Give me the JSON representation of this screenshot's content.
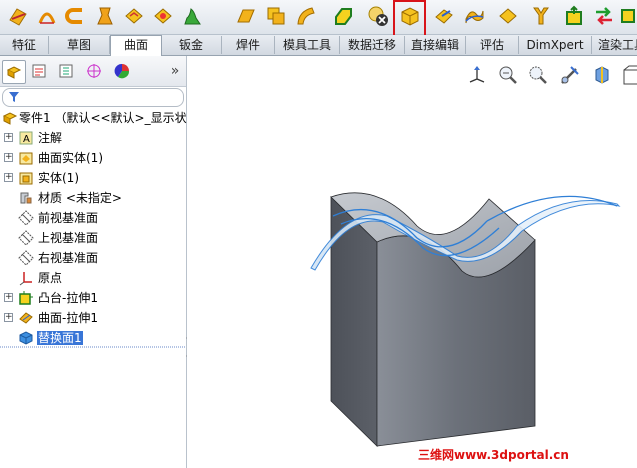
{
  "toolbar": {
    "icons": [
      "planar-surface-icon",
      "extruded-surface-icon",
      "revolved-surface-icon",
      "swept-surface-icon",
      "lofted-surface-icon",
      "boundary-surface-icon",
      "fill-surface-icon",
      "offset-surface-icon",
      "ruled-surface-icon",
      "knit-surface-icon",
      "thicken-icon",
      "delete-face-icon",
      "replace-face-icon",
      "extend-surface-icon",
      "trim-surface-icon",
      "untrim-surface-icon",
      "cut-with-surface-icon",
      "move-face-icon",
      "mirror-icon",
      "freeform-icon"
    ],
    "highlighted_tool": "replace-face-icon",
    "highlight_color": "#d8141a"
  },
  "tabs": {
    "items": [
      "特征",
      "草图",
      "曲面",
      "钣金",
      "焊件",
      "模具工具",
      "数据迁移",
      "直接编辑",
      "评估",
      "DimXpert",
      "渲染工具"
    ],
    "active": "曲面"
  },
  "panel": {
    "tabs": [
      "feature-manager-icon",
      "property-manager-icon",
      "configuration-manager-icon",
      "dimxpert-manager-icon",
      "display-manager-icon"
    ],
    "more": "»"
  },
  "tree": {
    "root": "零件1 （默认<<默认>_显示状态",
    "items": [
      {
        "label": "注解",
        "icon": "annotations-icon",
        "expand": "+"
      },
      {
        "label": "曲面实体(1)",
        "icon": "surface-bodies-icon",
        "expand": "+"
      },
      {
        "label": "实体(1)",
        "icon": "solid-bodies-icon",
        "expand": "+"
      },
      {
        "label": "材质 <未指定>",
        "icon": "material-icon",
        "expand": ""
      },
      {
        "label": "前视基准面",
        "icon": "plane-icon",
        "expand": ""
      },
      {
        "label": "上视基准面",
        "icon": "plane-icon",
        "expand": ""
      },
      {
        "label": "右视基准面",
        "icon": "plane-icon",
        "expand": ""
      },
      {
        "label": "原点",
        "icon": "origin-icon",
        "expand": ""
      },
      {
        "label": "凸台-拉伸1",
        "icon": "boss-extrude-icon",
        "expand": "+"
      },
      {
        "label": "曲面-拉伸1",
        "icon": "surface-extrude-icon",
        "expand": "+"
      },
      {
        "label": "替换面1",
        "icon": "replace-face-feature-icon",
        "expand": "",
        "selected": true
      }
    ]
  },
  "viewport": {
    "tools": [
      "view-orientation-icon",
      "zoom-to-fit-icon",
      "zoom-to-area-icon",
      "section-view-icon",
      "display-style-icon",
      "hide-show-icon"
    ]
  },
  "watermark": "三维网www.3dportal.cn",
  "colors": {
    "tab_active_bg": "#ffffff",
    "selection": "#3875d7",
    "model_face": "#6e737c",
    "surface_edge": "#2f7fd6"
  }
}
